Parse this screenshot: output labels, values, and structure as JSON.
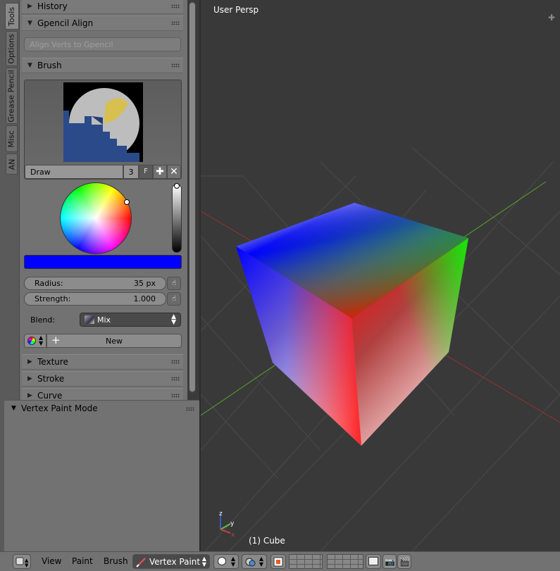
{
  "side_tabs": [
    "Tools",
    "Options",
    "Grease Pencil",
    "Misc",
    "AN"
  ],
  "panels": {
    "history": "History",
    "gpencil_align": "Gpencil Align",
    "align_verts_btn": "Align Verts to Gpencil",
    "brush": "Brush",
    "texture": "Texture",
    "stroke": "Stroke",
    "curve": "Curve"
  },
  "brush": {
    "name": "Draw",
    "users": "3",
    "fake_user": "F",
    "color_hex": "#0000ff",
    "radius_label": "Radius:",
    "radius_value": "35 px",
    "strength_label": "Strength:",
    "strength_value": "1.000",
    "blend_label": "Blend:",
    "blend_value": "Mix",
    "palette_new": "New"
  },
  "operator_panel": {
    "title": "Vertex Paint Mode"
  },
  "viewport": {
    "view_label": "User Persp",
    "object_label": "(1) Cube"
  },
  "footer": {
    "menus": [
      "View",
      "Paint",
      "Brush"
    ],
    "mode": "Vertex Paint"
  },
  "colors": {
    "grid_line": "#4a4a4a",
    "x_axis": "#9a3030",
    "y_axis": "#5aa030",
    "panel_bg": "#727272",
    "viewport_bg": "#393939"
  },
  "icons": {
    "editor_type": "3d-view-icon",
    "mode": "brush-icon",
    "shading": "solid-sphere-icon",
    "pivot": "pivot-icon",
    "layers": "layers-grid-icon",
    "render": "camera-icon"
  }
}
